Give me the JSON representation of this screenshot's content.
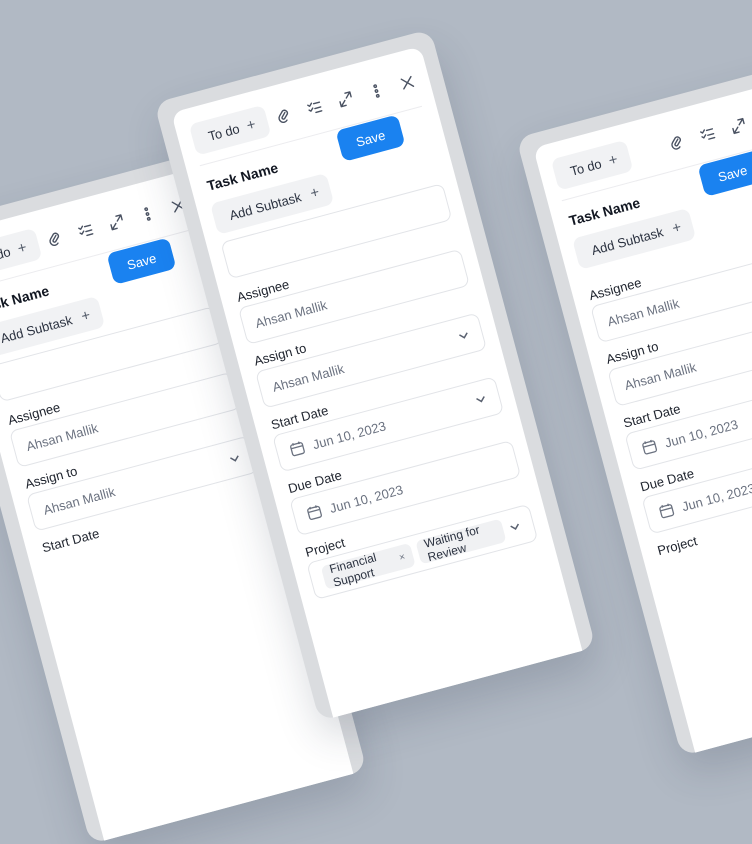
{
  "colors": {
    "background": "#b1b9c4",
    "accent": "#1a82f0",
    "panel": "#dadcdf"
  },
  "form": {
    "status_label": "To do",
    "add_icon": "plus-icon",
    "toolbar_icons": [
      "attach-icon",
      "checklist-icon",
      "expand-icon",
      "more-vertical-icon",
      "close-icon"
    ],
    "task_name_label": "Task Name",
    "save_label": "Save",
    "add_subtask_label": "Add Subtask",
    "task_name_value": "",
    "assignee_label": "Assignee",
    "assignee_placeholder": "Ahsan Mallik",
    "assign_to_label": "Assign to",
    "assign_to_value": "Ahsan Mallik",
    "start_date_label": "Start Date",
    "start_date_value": "Jun 10, 2023",
    "due_date_label": "Due Date",
    "due_date_value": "Jun 10, 2023",
    "project_label": "Project",
    "project_tags": [
      "Financial Support",
      "Waiting for Review"
    ],
    "tag_remove": "×"
  }
}
